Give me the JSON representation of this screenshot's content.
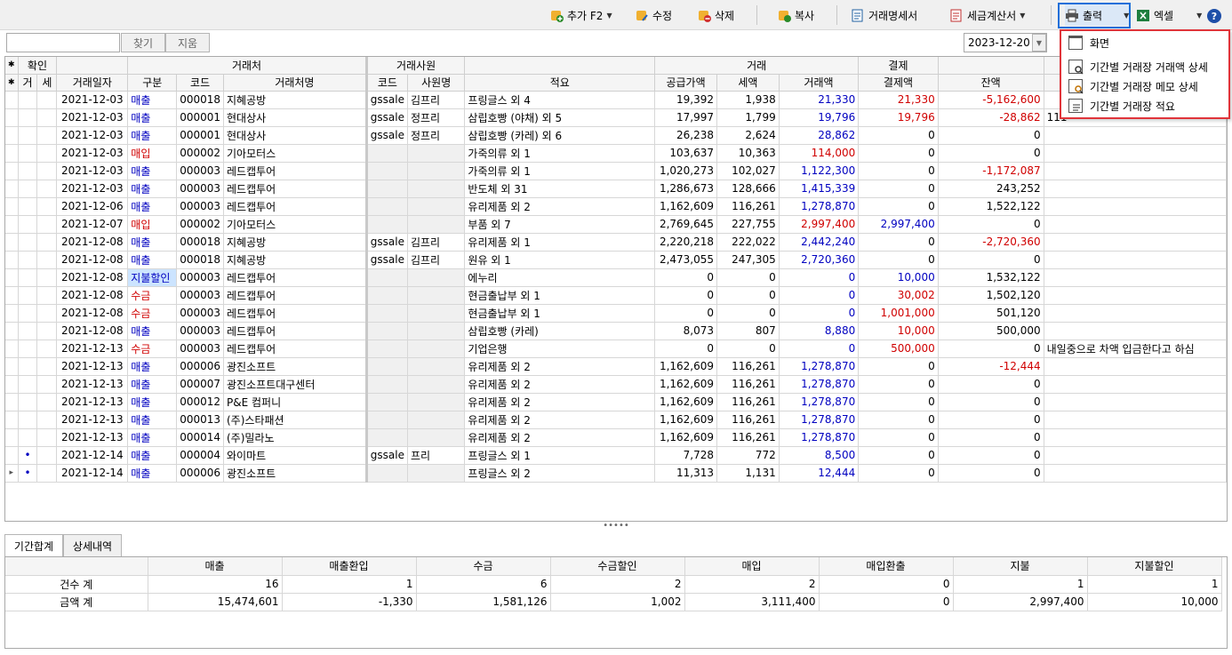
{
  "toolbar": {
    "add": "추가 F2",
    "edit": "수정",
    "delete": "삭제",
    "copy": "복사",
    "statement": "거래명세서",
    "invoice": "세금계산서",
    "print": "출력",
    "excel": "엑셀",
    "help": "?"
  },
  "search": {
    "find": "찾기",
    "clear": "지움",
    "date": "2023-12-20"
  },
  "grid": {
    "groups": {
      "confirm": "확인",
      "partner": "거래처",
      "staff": "거래사원",
      "trade": "거래",
      "settle": "결제"
    },
    "cols": {
      "g": "거",
      "s": "세",
      "date": "거래일자",
      "kind": "구분",
      "code": "코드",
      "name": "거래처명",
      "scode": "코드",
      "sname": "사원명",
      "desc": "적요",
      "supply": "공급가액",
      "tax": "세액",
      "amount": "거래액",
      "paid": "결제액",
      "balance": "잔액"
    },
    "rows": [
      {
        "date": "2021-12-03",
        "kind": "매출",
        "code": "000018",
        "name": "지혜공방",
        "scode": "gssale",
        "sname": "김프리",
        "desc": "프링글스 외 4",
        "supply": "19,392",
        "tax": "1,938",
        "amount": "21,330",
        "paid": "21,330",
        "balance": "-5,162,600",
        "memo": ""
      },
      {
        "date": "2021-12-03",
        "kind": "매출",
        "code": "000001",
        "name": "현대상사",
        "scode": "gssale",
        "sname": "정프리",
        "desc": "삼립호빵 (야채) 외 5",
        "supply": "17,997",
        "tax": "1,799",
        "amount": "19,796",
        "paid": "19,796",
        "balance": "-28,862",
        "memo": "111"
      },
      {
        "date": "2021-12-03",
        "kind": "매출",
        "code": "000001",
        "name": "현대상사",
        "scode": "gssale",
        "sname": "정프리",
        "desc": "삼립호빵 (카레) 외 6",
        "supply": "26,238",
        "tax": "2,624",
        "amount": "28,862",
        "paid": "0",
        "balance": "0",
        "memo": ""
      },
      {
        "date": "2021-12-03",
        "kind": "매입",
        "code": "000002",
        "name": "기아모터스",
        "scode": "",
        "sname": "",
        "desc": "가죽의류 외 1",
        "supply": "103,637",
        "tax": "10,363",
        "amount": "114,000",
        "paid": "0",
        "balance": "0",
        "memo": ""
      },
      {
        "date": "2021-12-03",
        "kind": "매출",
        "code": "000003",
        "name": "레드캡투어",
        "scode": "",
        "sname": "",
        "desc": "가죽의류 외 1",
        "supply": "1,020,273",
        "tax": "102,027",
        "amount": "1,122,300",
        "paid": "0",
        "balance": "-1,172,087",
        "memo": ""
      },
      {
        "date": "2021-12-03",
        "kind": "매출",
        "code": "000003",
        "name": "레드캡투어",
        "scode": "",
        "sname": "",
        "desc": "반도체 외 31",
        "supply": "1,286,673",
        "tax": "128,666",
        "amount": "1,415,339",
        "paid": "0",
        "balance": "243,252",
        "memo": ""
      },
      {
        "date": "2021-12-06",
        "kind": "매출",
        "code": "000003",
        "name": "레드캡투어",
        "scode": "",
        "sname": "",
        "desc": "유리제품 외 2",
        "supply": "1,162,609",
        "tax": "116,261",
        "amount": "1,278,870",
        "paid": "0",
        "balance": "1,522,122",
        "memo": ""
      },
      {
        "date": "2021-12-07",
        "kind": "매입",
        "code": "000002",
        "name": "기아모터스",
        "scode": "",
        "sname": "",
        "desc": "부품 외 7",
        "supply": "2,769,645",
        "tax": "227,755",
        "amount": "2,997,400",
        "paid": "2,997,400",
        "balance": "0",
        "memo": ""
      },
      {
        "date": "2021-12-08",
        "kind": "매출",
        "code": "000018",
        "name": "지혜공방",
        "scode": "gssale",
        "sname": "김프리",
        "desc": "유리제품 외 1",
        "supply": "2,220,218",
        "tax": "222,022",
        "amount": "2,442,240",
        "paid": "0",
        "balance": "-2,720,360",
        "memo": ""
      },
      {
        "date": "2021-12-08",
        "kind": "매출",
        "code": "000018",
        "name": "지혜공방",
        "scode": "gssale",
        "sname": "김프리",
        "desc": "원유 외 1",
        "supply": "2,473,055",
        "tax": "247,305",
        "amount": "2,720,360",
        "paid": "0",
        "balance": "0",
        "memo": ""
      },
      {
        "date": "2021-12-08",
        "kind": "지불할인",
        "code": "000003",
        "name": "레드캡투어",
        "scode": "",
        "sname": "",
        "desc": "에누리",
        "supply": "0",
        "tax": "0",
        "amount": "0",
        "paid": "10,000",
        "balance": "1,532,122",
        "memo": ""
      },
      {
        "date": "2021-12-08",
        "kind": "수금",
        "code": "000003",
        "name": "레드캡투어",
        "scode": "",
        "sname": "",
        "desc": "현금출납부 외 1",
        "supply": "0",
        "tax": "0",
        "amount": "0",
        "paid": "30,002",
        "balance": "1,502,120",
        "memo": ""
      },
      {
        "date": "2021-12-08",
        "kind": "수금",
        "code": "000003",
        "name": "레드캡투어",
        "scode": "",
        "sname": "",
        "desc": "현금출납부 외 1",
        "supply": "0",
        "tax": "0",
        "amount": "0",
        "paid": "1,001,000",
        "balance": "501,120",
        "memo": ""
      },
      {
        "date": "2021-12-08",
        "kind": "매출",
        "code": "000003",
        "name": "레드캡투어",
        "scode": "",
        "sname": "",
        "desc": "삼립호빵 (카레)",
        "supply": "8,073",
        "tax": "807",
        "amount": "8,880",
        "paid": "10,000",
        "balance": "500,000",
        "memo": ""
      },
      {
        "date": "2021-12-13",
        "kind": "수금",
        "code": "000003",
        "name": "레드캡투어",
        "scode": "",
        "sname": "",
        "desc": "기업은행",
        "supply": "0",
        "tax": "0",
        "amount": "0",
        "paid": "500,000",
        "balance": "0",
        "memo": "내일중으로 차액 입금한다고 하심"
      },
      {
        "date": "2021-12-13",
        "kind": "매출",
        "code": "000006",
        "name": "광진소프트",
        "scode": "",
        "sname": "",
        "desc": "유리제품 외 2",
        "supply": "1,162,609",
        "tax": "116,261",
        "amount": "1,278,870",
        "paid": "0",
        "balance": "-12,444",
        "memo": ""
      },
      {
        "date": "2021-12-13",
        "kind": "매출",
        "code": "000007",
        "name": "광진소프트대구센터",
        "scode": "",
        "sname": "",
        "desc": "유리제품 외 2",
        "supply": "1,162,609",
        "tax": "116,261",
        "amount": "1,278,870",
        "paid": "0",
        "balance": "0",
        "memo": ""
      },
      {
        "date": "2021-12-13",
        "kind": "매출",
        "code": "000012",
        "name": "P&E 컴퍼니",
        "scode": "",
        "sname": "",
        "desc": "유리제품 외 2",
        "supply": "1,162,609",
        "tax": "116,261",
        "amount": "1,278,870",
        "paid": "0",
        "balance": "0",
        "memo": ""
      },
      {
        "date": "2021-12-13",
        "kind": "매출",
        "code": "000013",
        "name": "(주)스타패션",
        "scode": "",
        "sname": "",
        "desc": "유리제품 외 2",
        "supply": "1,162,609",
        "tax": "116,261",
        "amount": "1,278,870",
        "paid": "0",
        "balance": "0",
        "memo": ""
      },
      {
        "date": "2021-12-13",
        "kind": "매출",
        "code": "000014",
        "name": "(주)밀라노",
        "scode": "",
        "sname": "",
        "desc": "유리제품 외 2",
        "supply": "1,162,609",
        "tax": "116,261",
        "amount": "1,278,870",
        "paid": "0",
        "balance": "0",
        "memo": ""
      },
      {
        "date": "2021-12-14",
        "kind": "매출",
        "code": "000004",
        "name": "와이마트",
        "scode": "gssale",
        "sname": "프리",
        "desc": "프링글스 외 1",
        "supply": "7,728",
        "tax": "772",
        "amount": "8,500",
        "paid": "0",
        "balance": "0",
        "memo": ""
      },
      {
        "date": "2021-12-14",
        "kind": "매출",
        "code": "000006",
        "name": "광진소프트",
        "scode": "",
        "sname": "",
        "desc": "프링글스 외 2",
        "supply": "11,313",
        "tax": "1,131",
        "amount": "12,444",
        "paid": "0",
        "balance": "0",
        "memo": ""
      }
    ]
  },
  "tabs": {
    "period": "기간합계",
    "detail": "상세내역"
  },
  "summary": {
    "headers": [
      "매출",
      "매출환입",
      "수금",
      "수금할인",
      "매입",
      "매입환출",
      "지불",
      "지불할인"
    ],
    "count_label": "건수 계",
    "counts": [
      "16",
      "1",
      "6",
      "2",
      "2",
      "0",
      "1",
      "1"
    ],
    "amount_label": "금액 계",
    "amounts": [
      "15,474,601",
      "-1,330",
      "1,581,126",
      "1,002",
      "3,111,400",
      "0",
      "2,997,400",
      "10,000"
    ]
  },
  "menu": {
    "screen": "화면",
    "amount_detail": "기간별 거래장 거래액 상세",
    "memo_detail": "기간별 거래장 메모 상세",
    "desc": "기간별 거래장 적요"
  }
}
